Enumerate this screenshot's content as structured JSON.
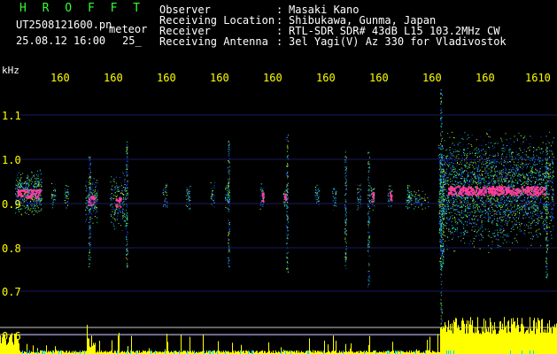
{
  "header": {
    "title": "H R O F F T",
    "filename": "UT2508121600.pn",
    "meteor": "meteor",
    "datetime": "25.08.12 16:00",
    "tag": "25_",
    "info": [
      {
        "key": "Observer",
        "sep": ":",
        "value": "Masaki Kano"
      },
      {
        "key": "Receiving Location",
        "sep": ":",
        "value": "Shibukawa, Gunma, Japan"
      },
      {
        "key": "Receiver",
        "sep": ":",
        "value": "RTL-SDR SDR# 43dB L15 103.2MHz CW"
      },
      {
        "key": "Receiving Antenna",
        "sep": ":",
        "value": "3el Yagi(V) Az 330 for Vladivostok"
      }
    ]
  },
  "axis": {
    "unit": "kHz",
    "y_ticks": [
      "1.1",
      "1.0",
      "0.9",
      "0.8",
      "0.7",
      "0.6"
    ],
    "x_ticks": [
      "160",
      "160",
      "160",
      "160",
      "160",
      "160",
      "160",
      "160",
      "160",
      "1610"
    ]
  },
  "colors": {
    "background": "#000000",
    "axis_label": "#ffff00",
    "title": "#32ff32",
    "text": "#ffffff",
    "echo_core": "#ff3c9c",
    "baseline": "#ffff00"
  }
}
